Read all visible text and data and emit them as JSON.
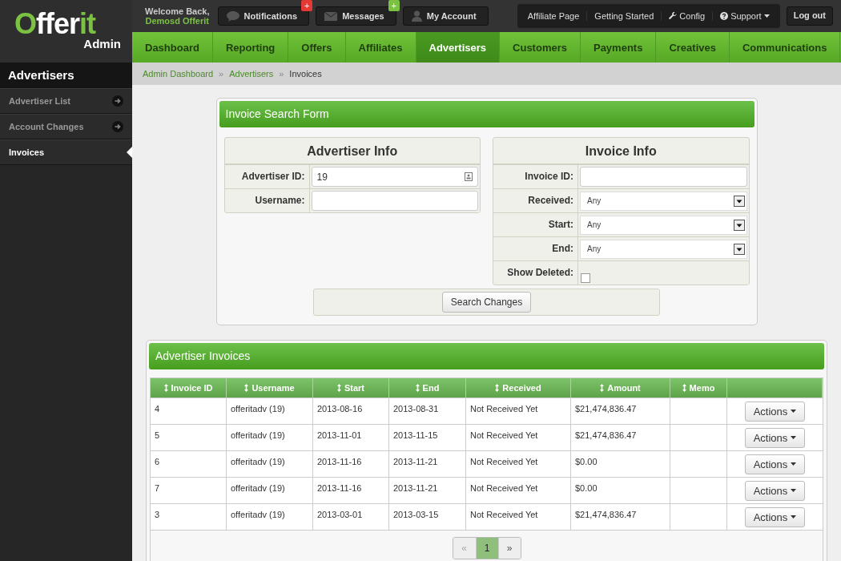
{
  "brand": {
    "logo_left": "O",
    "logo_main": "ffer",
    "logo_accent": "it",
    "subtitle": "Admin"
  },
  "welcome": {
    "greeting": "Welcome Back,",
    "name": "Demosd Offerit"
  },
  "top_buttons": [
    {
      "label": "Notifications",
      "badge": "+",
      "color": "#e53935"
    },
    {
      "label": "Messages",
      "badge": "+",
      "color": "#7cc242"
    },
    {
      "label": "My Account"
    }
  ],
  "top_links": [
    {
      "label": "Affiliate Page",
      "dropdown": false
    },
    {
      "label": "Getting Started",
      "dropdown": false
    },
    {
      "label": "Config",
      "dropdown": false
    },
    {
      "label": "Support",
      "dropdown": true
    }
  ],
  "logout": "Log out",
  "nav": [
    {
      "label": "Dashboard",
      "selected": false
    },
    {
      "label": "Reporting",
      "selected": false
    },
    {
      "label": "Offers",
      "selected": false
    },
    {
      "label": "Affiliates",
      "selected": false
    },
    {
      "label": "Advertisers",
      "selected": true
    },
    {
      "label": "Customers",
      "selected": false
    },
    {
      "label": "Payments",
      "selected": false
    },
    {
      "label": "Creatives",
      "selected": false
    },
    {
      "label": "Communications",
      "selected": false
    }
  ],
  "sidebar": {
    "title": "Advertisers",
    "items": [
      {
        "label": "Advertiser List",
        "selected": false
      },
      {
        "label": "Account Changes",
        "selected": false
      },
      {
        "label": "Invoices",
        "selected": true
      }
    ]
  },
  "breadcrumb": {
    "items": [
      "Admin Dashboard",
      "Advertisers",
      "Invoices"
    ],
    "separator": "»"
  },
  "search_form": {
    "title": "Invoice Search Form",
    "sections": [
      {
        "title": "Advertiser Info",
        "fields": [
          {
            "label": "Advertiser ID:",
            "kind": "lookup",
            "value": "19"
          },
          {
            "label": "Username:",
            "kind": "text"
          }
        ]
      },
      {
        "title": "Invoice Info",
        "fields": [
          {
            "label": "Invoice ID:",
            "kind": "text"
          },
          {
            "label": "Received:",
            "kind": "select",
            "value": "Any"
          },
          {
            "label": "Start:",
            "kind": "select",
            "value": "Any"
          },
          {
            "label": "End:",
            "kind": "select",
            "value": "Any"
          },
          {
            "label": "Show Deleted:",
            "kind": "checkbox",
            "checked": false
          }
        ]
      }
    ],
    "submit": "Search Changes"
  },
  "invoices": {
    "title": "Advertiser Invoices",
    "columns": [
      "Invoice ID",
      "Username",
      "Start",
      "End",
      "Received",
      "Amount",
      "Memo"
    ],
    "rows": [
      {
        "cells": [
          "4",
          "offeritadv (19)",
          "2013-08-16",
          "2013-08-31",
          "Not Received Yet",
          "$21,474,836.47"
        ],
        "action": "Actions"
      },
      {
        "cells": [
          "5",
          "offeritadv (19)",
          "2013-11-01",
          "2013-11-15",
          "Not Received Yet",
          "$21,474,836.47"
        ],
        "action": "Actions"
      },
      {
        "cells": [
          "6",
          "offeritadv (19)",
          "2013-11-16",
          "2013-11-21",
          "Not Received Yet",
          "$0.00"
        ],
        "action": "Actions"
      },
      {
        "cells": [
          "7",
          "offeritadv (19)",
          "2013-11-16",
          "2013-11-21",
          "Not Received Yet",
          "$0.00"
        ],
        "action": "Actions"
      },
      {
        "cells": [
          "3",
          "offeritadv (19)",
          "2013-03-01",
          "2013-03-15",
          "Not Received Yet",
          "$21,474,836.47"
        ],
        "action": "Actions"
      }
    ],
    "pagination": {
      "prev": "«",
      "pages": [
        {
          "label": "1",
          "selected": true
        }
      ],
      "next": "»"
    }
  }
}
